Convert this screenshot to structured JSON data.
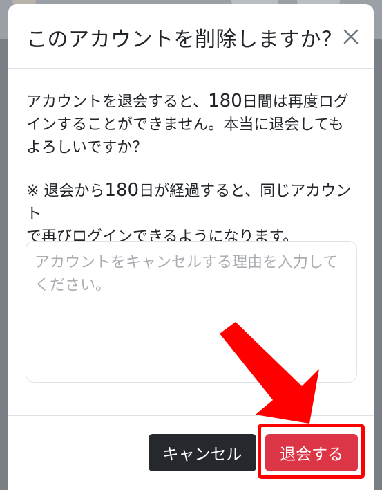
{
  "dialog": {
    "title": "このアカウントを削除しますか？",
    "close_symbol": "×",
    "message": {
      "line1_pre": "アカウントを退会すると、",
      "line1_num": "180",
      "line1_post": "日間は再度ログ",
      "line2": "インすることができません。本当に退会しても",
      "line3": "よろしいですか？"
    },
    "note": {
      "line1_pre": "※ 退会から",
      "line1_num": "180",
      "line1_post": "日が経過すると、同じアカウント",
      "line2": "で再びログインできるようになります。"
    },
    "reason_input": {
      "value": "",
      "placeholder": "アカウントをキャンセルする理由を入力してください。"
    },
    "buttons": {
      "cancel_label": "キャンセル",
      "withdraw_label": "退会する"
    }
  },
  "colors": {
    "danger": "#dc3545",
    "dark": "#25292d",
    "annotation": "#ff0000",
    "backdrop": "#7a7f85"
  },
  "icons": {
    "close": "close-icon",
    "annotation": "red-arrow-icon"
  }
}
